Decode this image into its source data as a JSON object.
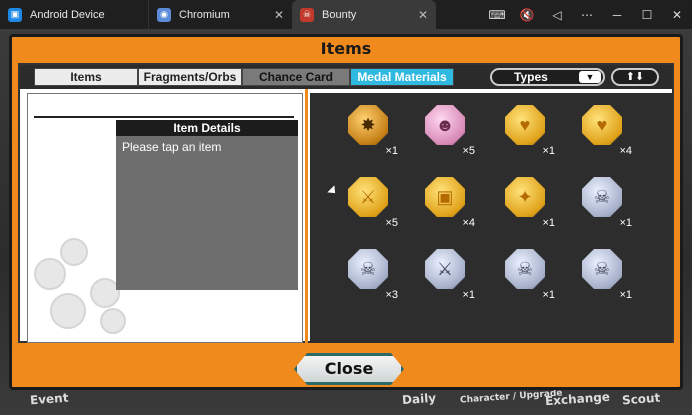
{
  "window": {
    "tabs": [
      {
        "label": "Android Device",
        "icon": "android-device-icon"
      },
      {
        "label": "Chromium",
        "icon": "chromium-icon"
      },
      {
        "label": "Bounty",
        "icon": "bounty-app-icon"
      }
    ],
    "controls": [
      "keyboard-icon",
      "mute-icon",
      "back-icon",
      "more-icon",
      "minimize-icon",
      "maximize-icon",
      "close-window-icon"
    ]
  },
  "dialog": {
    "title": "Items",
    "tabs": [
      "Items",
      "Fragments/Orbs",
      "Chance Card",
      "Medal Materials"
    ],
    "active_tab": "Medal Materials",
    "types_label": "Types",
    "details_title": "Item Details",
    "details_prompt": "Please tap an item",
    "close_label": "Close"
  },
  "medals": [
    {
      "kind": "bronze",
      "glyph": "✸",
      "count": "×1"
    },
    {
      "kind": "pink",
      "glyph": "☻",
      "count": "×5"
    },
    {
      "kind": "gold",
      "glyph": "♥",
      "count": "×1"
    },
    {
      "kind": "gold",
      "glyph": "♥",
      "count": "×4"
    },
    {
      "kind": "gold",
      "glyph": "⚔",
      "count": "×5"
    },
    {
      "kind": "gold",
      "glyph": "▣",
      "count": "×4"
    },
    {
      "kind": "gold",
      "glyph": "✦",
      "count": "×1"
    },
    {
      "kind": "silver",
      "glyph": "☠",
      "count": "×1"
    },
    {
      "kind": "silver",
      "glyph": "☠",
      "count": "×3"
    },
    {
      "kind": "silver",
      "glyph": "⚔",
      "count": "×1"
    },
    {
      "kind": "silver",
      "glyph": "☠",
      "count": "×1"
    },
    {
      "kind": "silver",
      "glyph": "☠",
      "count": "×1"
    }
  ],
  "bottom_nav": [
    "Event",
    "Daily",
    "Character / Upgrade",
    "Exchange",
    "Scout"
  ],
  "colors": {
    "accent": "#f08a1c",
    "active_tab": "#2fb9e0",
    "panel_dark": "#2d2d2d"
  }
}
